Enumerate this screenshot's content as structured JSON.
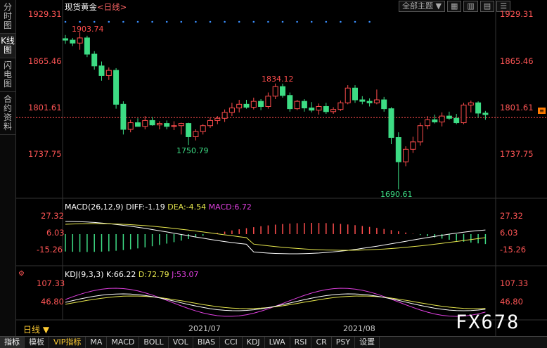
{
  "left_tabs": [
    "分时图",
    "K线图",
    "闪电图",
    "合约资料"
  ],
  "left_tab_active": 1,
  "main_header": {
    "name": "现货黄金",
    "period": "<日线>"
  },
  "top_controls": {
    "theme": "全部主题",
    "theme_arrow": "▼",
    "icons": [
      "grid-icon",
      "bars-icon",
      "lines-icon",
      "menu-icon"
    ]
  },
  "price_axis": {
    "labels": [
      "1929.31",
      "1865.46",
      "1801.61",
      "1737.75"
    ],
    "min": 1680,
    "max": 1930
  },
  "annotations": {
    "high1": "1903.74",
    "high2": "1834.12",
    "low1": "1750.79",
    "low2": "1690.61"
  },
  "current_price_marker": "1788",
  "macd": {
    "header": {
      "title": "MACD(26,12,9)",
      "diff": "DIFF:-1.19",
      "dea": "DEA:-4.54",
      "macd": "MACD:6.72"
    },
    "labels": [
      "27.32",
      "6.03",
      "-15.26"
    ]
  },
  "kdj": {
    "header": {
      "title": "KDJ(9,3,3)",
      "k": "K:66.22",
      "d": "D:72.79",
      "j": "J:53.07"
    },
    "labels": [
      "107.33",
      "46.80"
    ]
  },
  "dates": [
    "2021/07",
    "2021/08"
  ],
  "period_label": "日线",
  "watermark": "FX678",
  "bottom_tabs": [
    "指标",
    "模板",
    "VIP指标",
    "MA",
    "MACD",
    "BOLL",
    "VOL",
    "BIAS",
    "CCI",
    "KDJ",
    "LWA",
    "RSI",
    "CR",
    "PSY",
    "设置"
  ],
  "colors": {
    "up": "#ff4d4d",
    "down": "#3ddc84",
    "diff": "#ffffff",
    "dea": "#e6e64d",
    "j": "#e040e0"
  },
  "chart_data": {
    "type": "candlestick",
    "candles": [
      [
        1895,
        1900,
        1888,
        1893
      ],
      [
        1893,
        1896,
        1885,
        1889
      ],
      [
        1889,
        1903.74,
        1880,
        1896
      ],
      [
        1896,
        1899,
        1870,
        1874
      ],
      [
        1874,
        1878,
        1853,
        1858
      ],
      [
        1858,
        1864,
        1838,
        1845
      ],
      [
        1845,
        1856,
        1839,
        1852
      ],
      [
        1852,
        1855,
        1800,
        1806
      ],
      [
        1806,
        1810,
        1765,
        1772
      ],
      [
        1772,
        1785,
        1768,
        1781
      ],
      [
        1781,
        1787,
        1776,
        1776
      ],
      [
        1776,
        1790,
        1772,
        1784
      ],
      [
        1784,
        1789,
        1777,
        1778
      ],
      [
        1778,
        1783,
        1772,
        1780
      ],
      [
        1780,
        1784,
        1772,
        1776
      ],
      [
        1776,
        1783,
        1771,
        1777
      ],
      [
        1777,
        1781,
        1765,
        1780
      ],
      [
        1780,
        1781,
        1750.79,
        1762
      ],
      [
        1762,
        1772,
        1757,
        1769
      ],
      [
        1769,
        1779,
        1765,
        1777
      ],
      [
        1777,
        1788,
        1774,
        1784
      ],
      [
        1784,
        1790,
        1779,
        1787
      ],
      [
        1787,
        1799,
        1782,
        1795
      ],
      [
        1795,
        1808,
        1790,
        1801
      ],
      [
        1801,
        1812,
        1795,
        1806
      ],
      [
        1806,
        1812,
        1800,
        1802
      ],
      [
        1802,
        1815,
        1799,
        1810
      ],
      [
        1810,
        1813,
        1798,
        1803
      ],
      [
        1803,
        1822,
        1800,
        1817
      ],
      [
        1817,
        1834.12,
        1813,
        1830
      ],
      [
        1830,
        1834,
        1815,
        1818
      ],
      [
        1818,
        1822,
        1796,
        1800
      ],
      [
        1800,
        1812,
        1798,
        1810
      ],
      [
        1810,
        1813,
        1796,
        1801
      ],
      [
        1801,
        1809,
        1795,
        1798
      ],
      [
        1798,
        1807,
        1792,
        1803
      ],
      [
        1803,
        1808,
        1793,
        1796
      ],
      [
        1796,
        1802,
        1793,
        1799
      ],
      [
        1799,
        1811,
        1797,
        1808
      ],
      [
        1808,
        1832,
        1806,
        1828
      ],
      [
        1828,
        1832,
        1808,
        1812
      ],
      [
        1812,
        1817,
        1806,
        1810
      ],
      [
        1810,
        1814,
        1803,
        1808
      ],
      [
        1808,
        1826,
        1806,
        1812
      ],
      [
        1812,
        1816,
        1796,
        1800
      ],
      [
        1800,
        1802,
        1752,
        1761
      ],
      [
        1761,
        1768,
        1690.61,
        1728
      ],
      [
        1728,
        1749,
        1722,
        1745
      ],
      [
        1745,
        1762,
        1740,
        1755
      ],
      [
        1755,
        1781,
        1750,
        1777
      ],
      [
        1777,
        1790,
        1772,
        1785
      ],
      [
        1785,
        1792,
        1780,
        1782
      ],
      [
        1782,
        1795,
        1776,
        1790
      ],
      [
        1790,
        1796,
        1785,
        1787
      ],
      [
        1787,
        1793,
        1779,
        1781
      ],
      [
        1781,
        1808,
        1779,
        1805
      ],
      [
        1805,
        1811,
        1795,
        1808
      ],
      [
        1808,
        1810,
        1788,
        1794
      ],
      [
        1794,
        1797,
        1785,
        1792
      ]
    ]
  }
}
